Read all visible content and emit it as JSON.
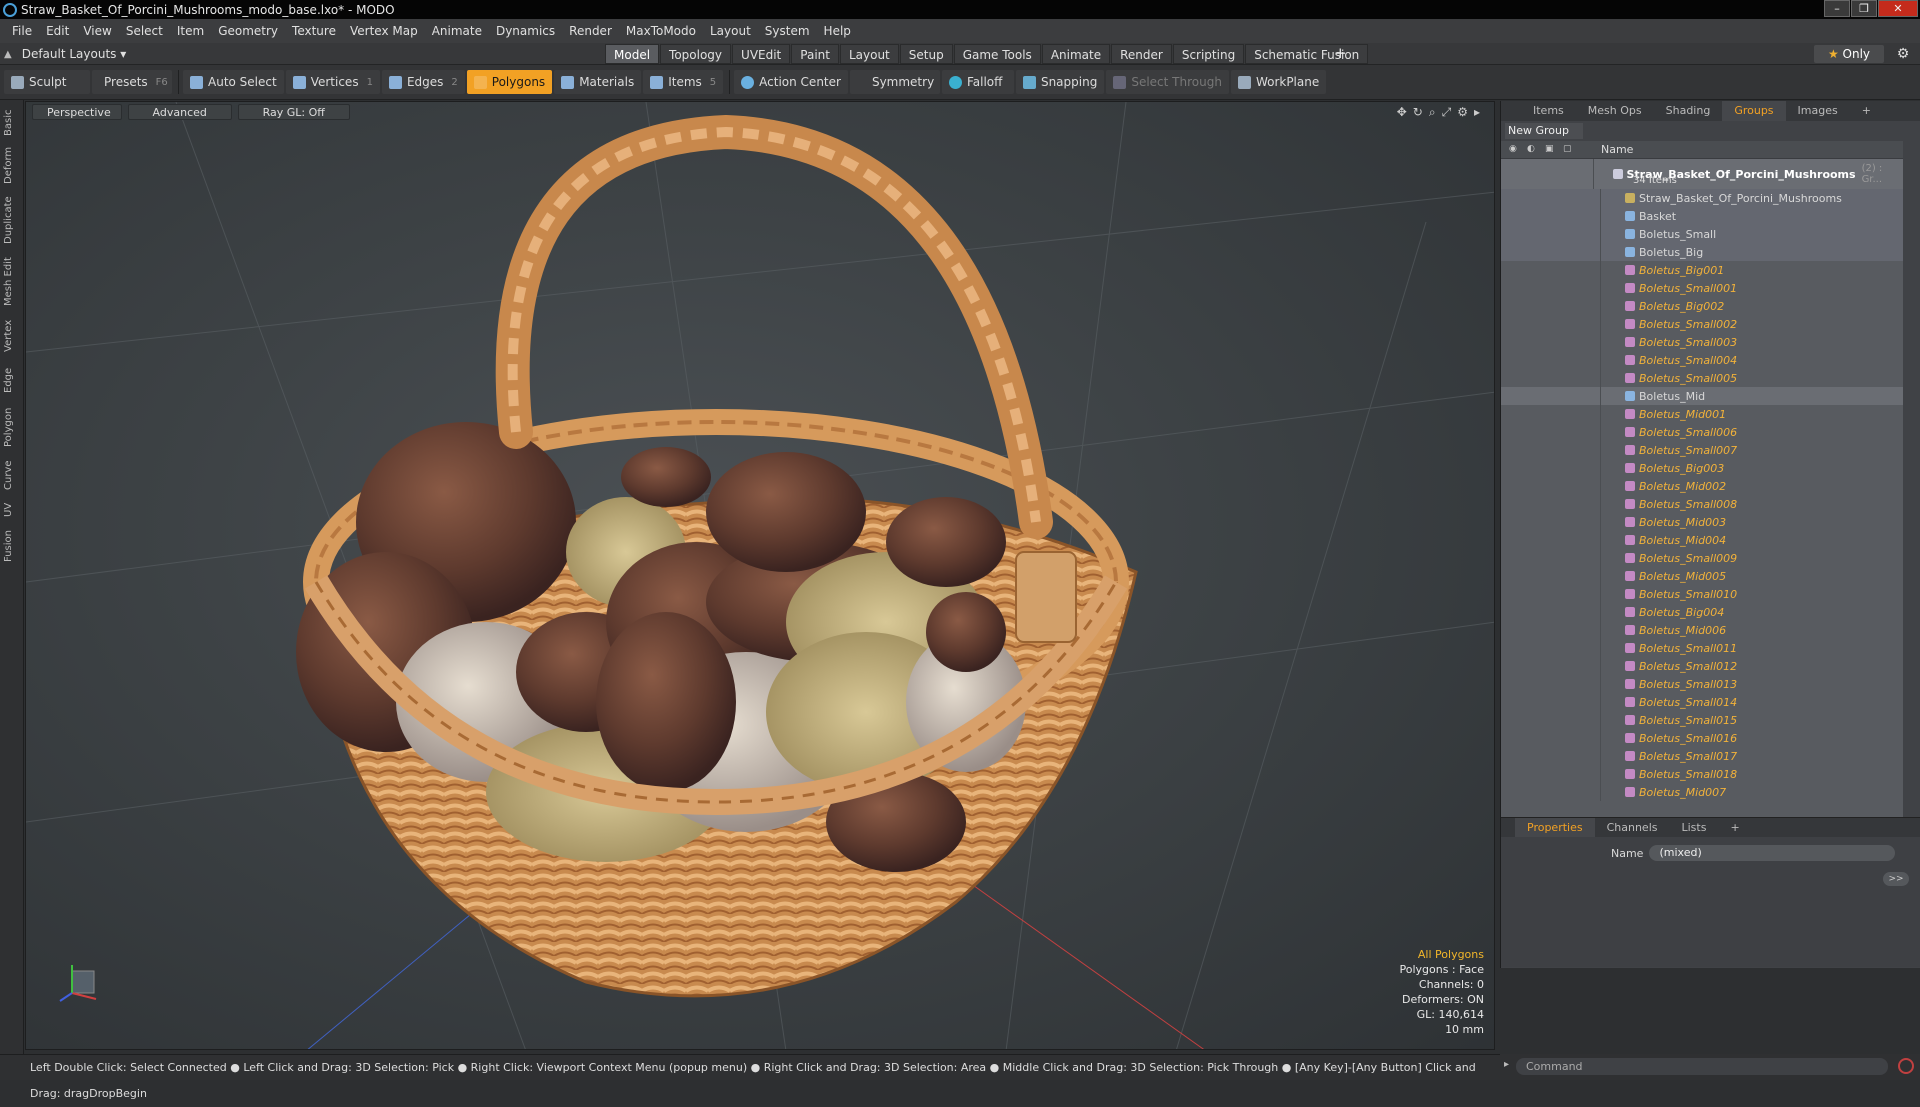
{
  "title": "Straw_Basket_Of_Porcini_Mushrooms_modo_base.lxo* - MODO",
  "menu": [
    "File",
    "Edit",
    "View",
    "Select",
    "Item",
    "Geometry",
    "Texture",
    "Vertex Map",
    "Animate",
    "Dynamics",
    "Render",
    "MaxToModo",
    "Layout",
    "System",
    "Help"
  ],
  "layout_dropdown": "Default Layouts ▾",
  "layout_tabs": [
    "Model",
    "Topology",
    "UVEdit",
    "Paint",
    "Layout",
    "Setup",
    "Game Tools",
    "Animate",
    "Render",
    "Scripting",
    "Schematic Fusion"
  ],
  "only_label": "Only",
  "toolbar": {
    "sculpt": "Sculpt",
    "presets": "Presets",
    "presets_key": "F6",
    "auto_select": "Auto Select",
    "vertices": "Vertices",
    "vertices_key": "1",
    "edges": "Edges",
    "edges_key": "2",
    "polygons": "Polygons",
    "materials": "Materials",
    "items": "Items",
    "items_key": "5",
    "action_center": "Action Center",
    "symmetry": "Symmetry",
    "falloff": "Falloff",
    "snapping": "Snapping",
    "select_through": "Select Through",
    "workplane": "WorkPlane"
  },
  "left_tabs": [
    "Basic",
    "Deform",
    "Duplicate",
    "Mesh Edit",
    "Vertex",
    "Edge",
    "Polygon",
    "Curve",
    "UV",
    "Fusion"
  ],
  "viewport": {
    "perspective": "Perspective",
    "advanced": "Advanced",
    "raygl": "Ray GL: Off"
  },
  "stats": {
    "selection": "All Polygons",
    "polygons": "Polygons : Face",
    "channels": "Channels: 0",
    "deformers": "Deformers: ON",
    "gl": "GL: 140,614",
    "size": "10 mm"
  },
  "right_tabs": [
    "Items",
    "Mesh Ops",
    "Shading",
    "Groups",
    "Images",
    "+"
  ],
  "new_group": "New Group",
  "tree_header": "Name",
  "group": {
    "name": "Straw_Basket_Of_Porcini_Mushrooms",
    "count_suffix": "(2) : Gr...",
    "items_label": "34 Items"
  },
  "tree_items": [
    {
      "label": "Straw_Basket_Of_Porcini_Mushrooms",
      "kind": "loc"
    },
    {
      "label": "Basket",
      "kind": "mesh"
    },
    {
      "label": "Boletus_Small",
      "kind": "mesh"
    },
    {
      "label": "Boletus_Big",
      "kind": "mesh"
    },
    {
      "label": "Boletus_Big001",
      "kind": "inst"
    },
    {
      "label": "Boletus_Small001",
      "kind": "inst"
    },
    {
      "label": "Boletus_Big002",
      "kind": "inst"
    },
    {
      "label": "Boletus_Small002",
      "kind": "inst"
    },
    {
      "label": "Boletus_Small003",
      "kind": "inst"
    },
    {
      "label": "Boletus_Small004",
      "kind": "inst"
    },
    {
      "label": "Boletus_Small005",
      "kind": "inst"
    },
    {
      "label": "Boletus_Mid",
      "kind": "mesh"
    },
    {
      "label": "Boletus_Mid001",
      "kind": "inst"
    },
    {
      "label": "Boletus_Small006",
      "kind": "inst"
    },
    {
      "label": "Boletus_Small007",
      "kind": "inst"
    },
    {
      "label": "Boletus_Big003",
      "kind": "inst"
    },
    {
      "label": "Boletus_Mid002",
      "kind": "inst"
    },
    {
      "label": "Boletus_Small008",
      "kind": "inst"
    },
    {
      "label": "Boletus_Mid003",
      "kind": "inst"
    },
    {
      "label": "Boletus_Mid004",
      "kind": "inst"
    },
    {
      "label": "Boletus_Small009",
      "kind": "inst"
    },
    {
      "label": "Boletus_Mid005",
      "kind": "inst"
    },
    {
      "label": "Boletus_Small010",
      "kind": "inst"
    },
    {
      "label": "Boletus_Big004",
      "kind": "inst"
    },
    {
      "label": "Boletus_Mid006",
      "kind": "inst"
    },
    {
      "label": "Boletus_Small011",
      "kind": "inst"
    },
    {
      "label": "Boletus_Small012",
      "kind": "inst"
    },
    {
      "label": "Boletus_Small013",
      "kind": "inst"
    },
    {
      "label": "Boletus_Small014",
      "kind": "inst"
    },
    {
      "label": "Boletus_Small015",
      "kind": "inst"
    },
    {
      "label": "Boletus_Small016",
      "kind": "inst"
    },
    {
      "label": "Boletus_Small017",
      "kind": "inst"
    },
    {
      "label": "Boletus_Small018",
      "kind": "inst"
    },
    {
      "label": "Boletus_Mid007",
      "kind": "inst"
    }
  ],
  "props_tabs": [
    "Properties",
    "Channels",
    "Lists",
    "+"
  ],
  "props": {
    "name_label": "Name",
    "name_value": "(mixed)",
    "more": ">>"
  },
  "command_placeholder": "Command",
  "status": "Left Double Click: Select Connected ● Left Click and Drag: 3D Selection: Pick ● Right Click: Viewport Context Menu (popup menu) ● Right Click and Drag: 3D Selection: Area ● Middle Click and Drag: 3D Selection: Pick Through ● [Any Key]-[Any Button] Click and Drag: dragDropBegin",
  "colors": {
    "accent": "#f2a124",
    "instance_text": "#f2b23a",
    "selection_text": "#f2b62a"
  }
}
